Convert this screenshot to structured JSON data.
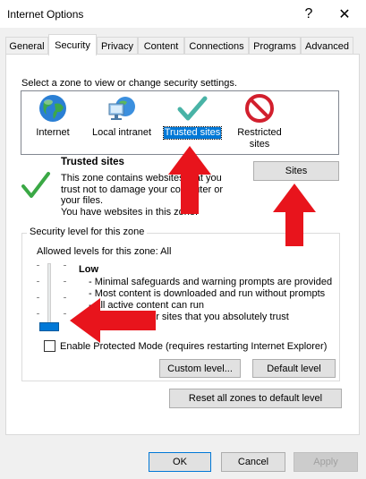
{
  "window": {
    "title": "Internet Options",
    "help_glyph": "?",
    "close_glyph": "✕"
  },
  "tabs": [
    {
      "label": "General",
      "active": false
    },
    {
      "label": "Security",
      "active": true
    },
    {
      "label": "Privacy",
      "active": false
    },
    {
      "label": "Content",
      "active": false
    },
    {
      "label": "Connections",
      "active": false
    },
    {
      "label": "Programs",
      "active": false
    },
    {
      "label": "Advanced",
      "active": false
    }
  ],
  "zones": {
    "prompt": "Select a zone to view or change security settings.",
    "items": [
      {
        "label": "Internet",
        "icon": "globe-icon"
      },
      {
        "label": "Local intranet",
        "icon": "computer-network-icon"
      },
      {
        "label": "Trusted sites",
        "icon": "checkmark-icon",
        "selected": true
      },
      {
        "label_line1": "Restricted",
        "label_line2": "sites",
        "icon": "restricted-icon"
      }
    ]
  },
  "zone_info": {
    "title": "Trusted sites",
    "desc_lines": [
      "This zone contains websites that you",
      "trust not to damage your computer or",
      "your files.",
      "You have websites in this zone."
    ],
    "sites_button": "Sites"
  },
  "security_level": {
    "legend": "Security level for this zone",
    "allowed": "Allowed levels for this zone: All",
    "level_name": "Low",
    "level_fraction": 0.0,
    "desc_lines": [
      "- Minimal safeguards and warning prompts are provided",
      "- Most content is downloaded and run without prompts",
      "- All active content can run",
      "- Appropriate for sites that you absolutely trust"
    ],
    "protected_mode": "Enable Protected Mode (requires restarting Internet Explorer)",
    "protected_checked": false,
    "custom_button": "Custom level...",
    "default_button": "Default level"
  },
  "reset_button": "Reset all zones to default level",
  "footer": {
    "ok": "OK",
    "cancel": "Cancel",
    "apply": "Apply"
  },
  "colors": {
    "accent": "#0078d7",
    "annotation_arrow": "#e8141c"
  }
}
